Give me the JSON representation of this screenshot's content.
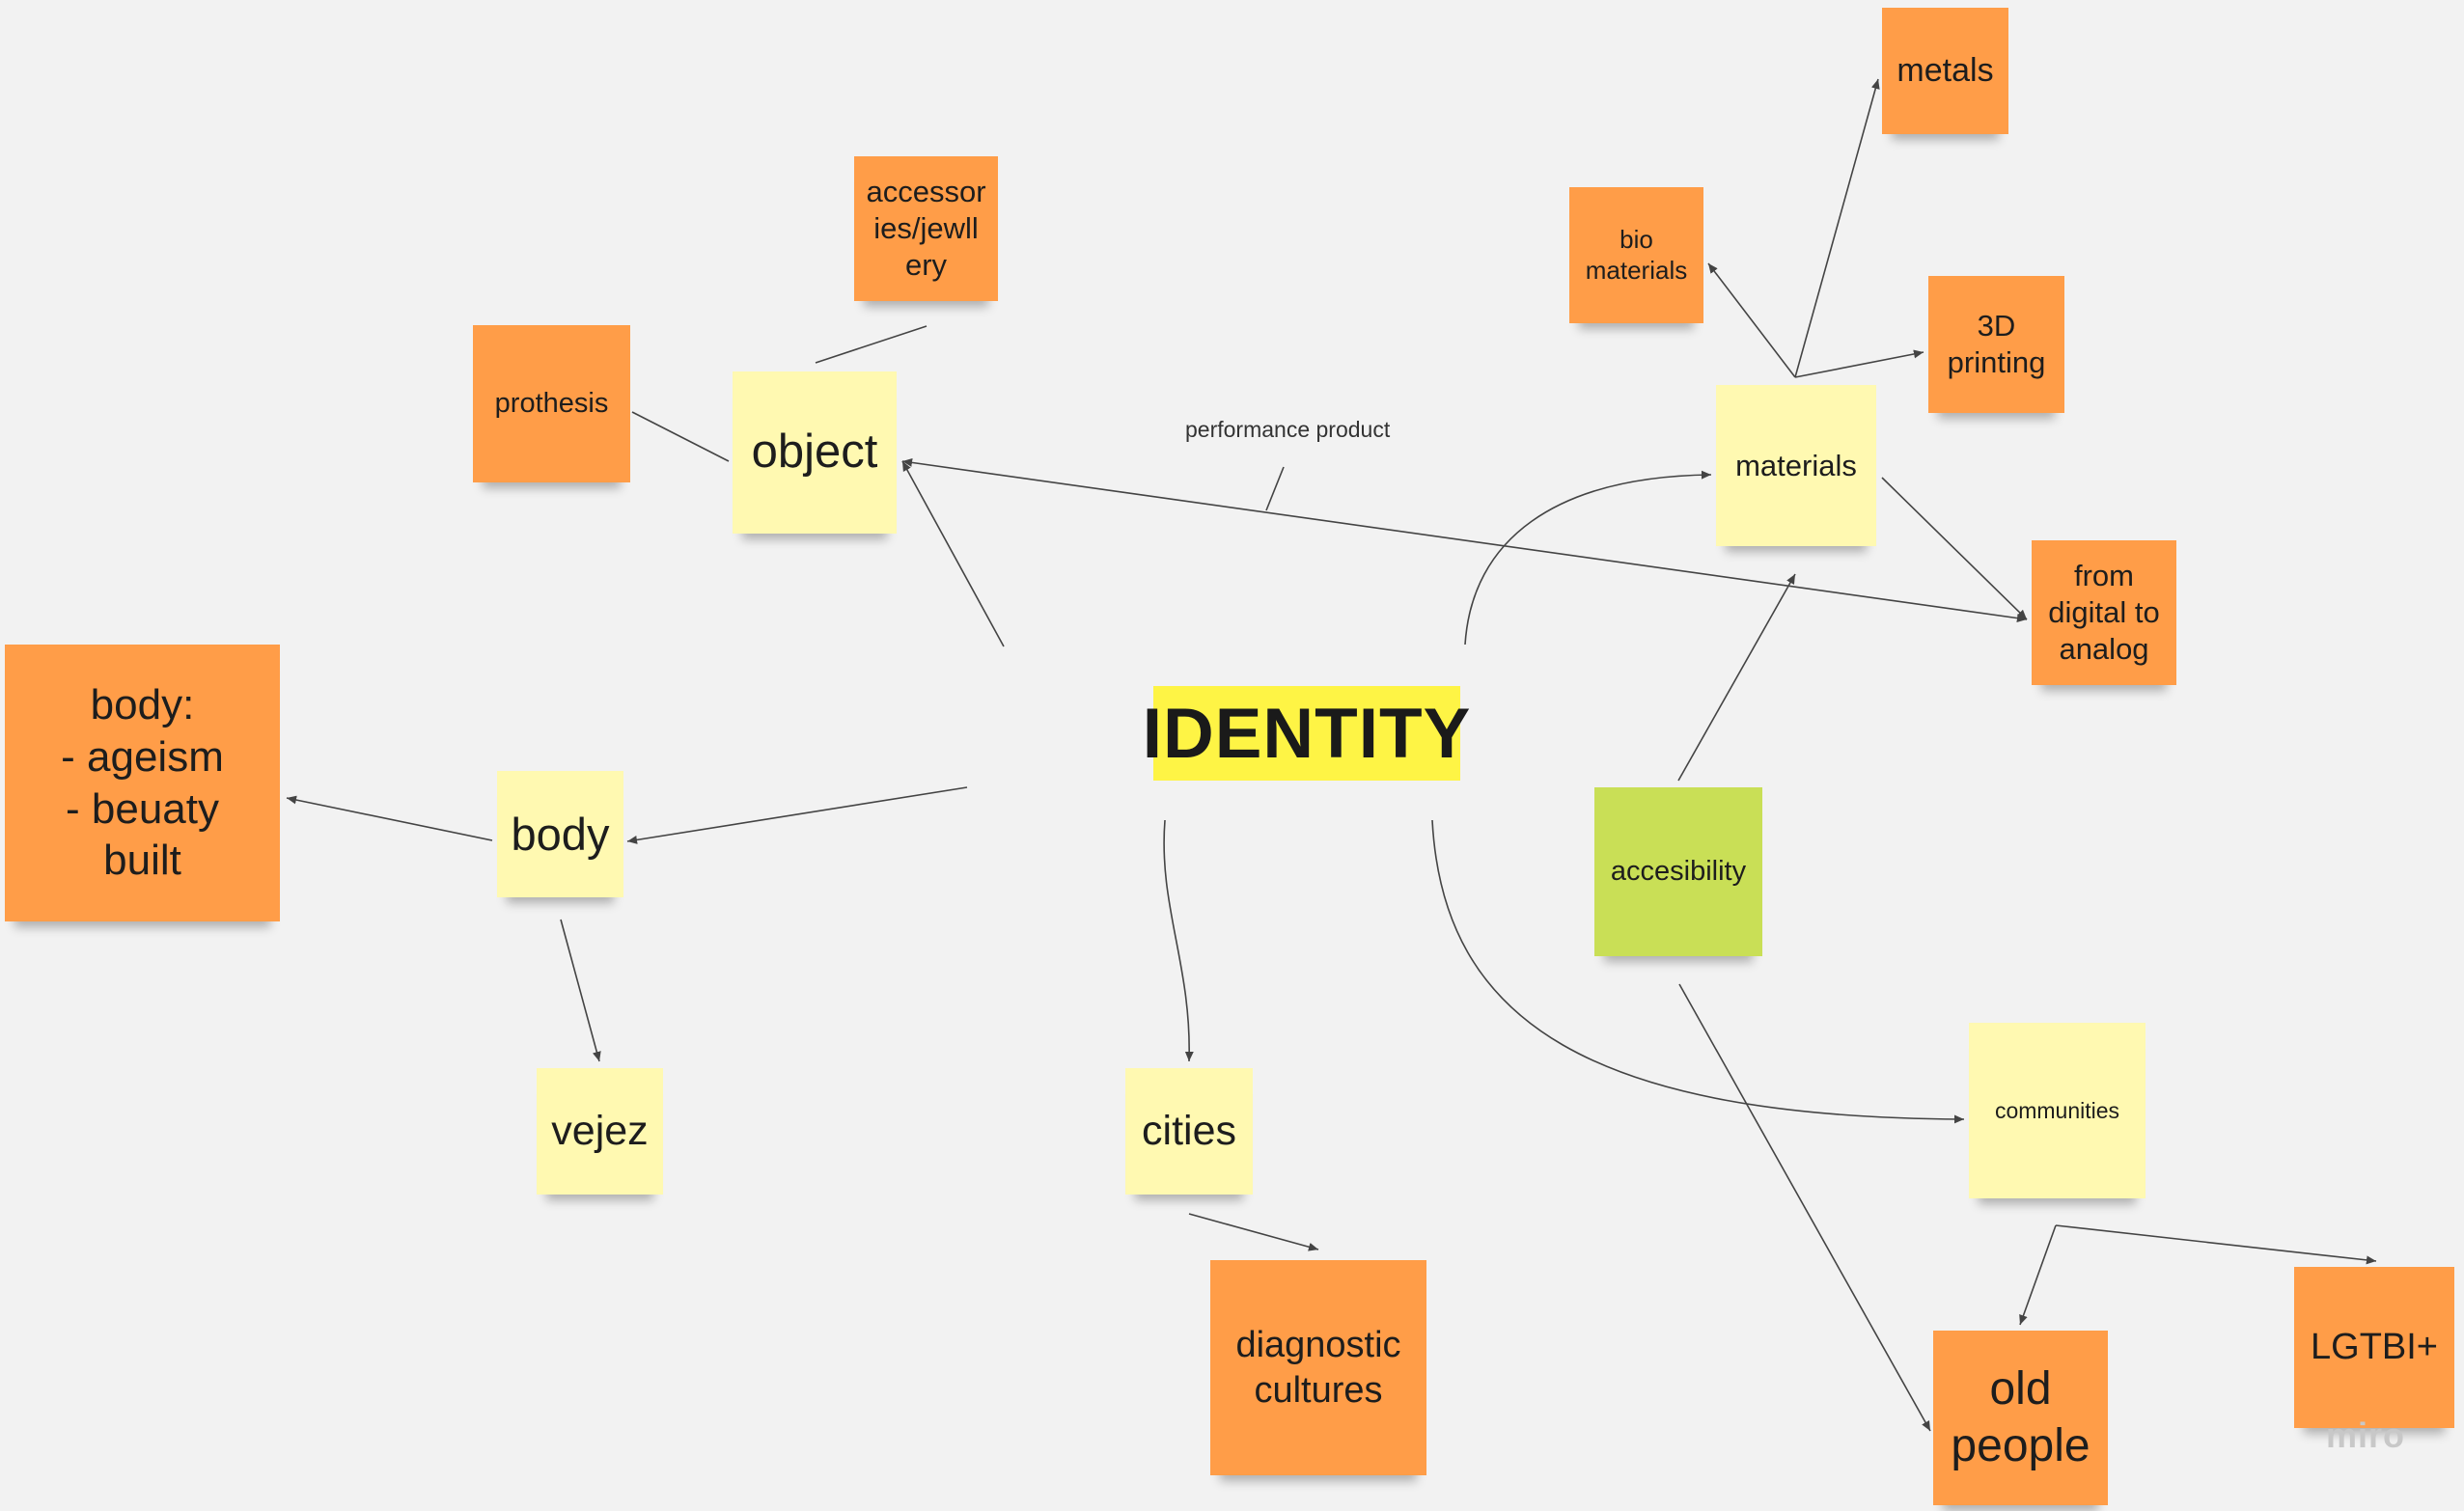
{
  "title": "IDENTITY",
  "connector_label": "performance product",
  "logo_text": "miro",
  "colors": {
    "yellow": "#fff9b1",
    "orange": "#ff9d48",
    "green": "#c9df56",
    "title": "#fef445",
    "line": "#444444",
    "canvas": "#f2f2f2"
  },
  "notes": {
    "object": "object",
    "accessories": "accessor\nies/jewll\nery",
    "prothesis": "prothesis",
    "body_detail": "body:\n- ageism\n- beuaty\nbuilt",
    "body": "body",
    "vejez": "vejez",
    "cities": "cities",
    "diagnostic": "diagnostic\ncultures",
    "metals": "metals",
    "bio": "bio\nmaterials",
    "printing": "3D\nprinting",
    "materials": "materials",
    "digital": "from\ndigital to\nanalog",
    "accesibility": "accesibility",
    "communities": "communities",
    "old_people": "old\npeople",
    "lgtbi": "LGTBI+"
  }
}
